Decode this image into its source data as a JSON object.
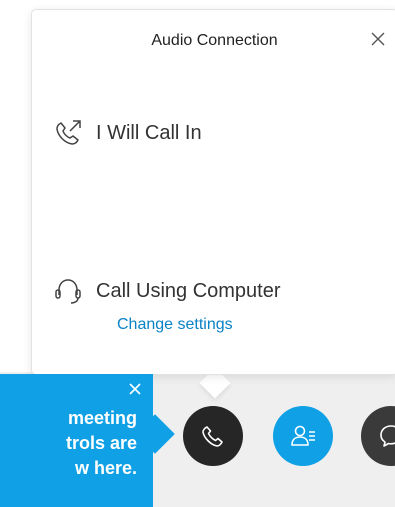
{
  "dialog": {
    "title": "Audio Connection",
    "close_icon": "close-icon",
    "options": [
      {
        "label": "I Will Call In",
        "icon": "phone-outgoing-icon"
      },
      {
        "label": "Call Using Computer",
        "icon": "headset-icon"
      }
    ],
    "change_settings_label": "Change settings"
  },
  "coach_mark": {
    "text": "meeting\ntrols are\nw here.",
    "close_icon": "close-icon"
  },
  "controls": [
    {
      "icon": "phone-icon",
      "color": "#262626"
    },
    {
      "icon": "participants-icon",
      "color": "#10a0e6"
    },
    {
      "icon": "chat-icon",
      "color": "#3a3a3a"
    }
  ],
  "colors": {
    "accent": "#10a0e6",
    "link": "#0a82c6",
    "control_bar": "#efefef"
  }
}
